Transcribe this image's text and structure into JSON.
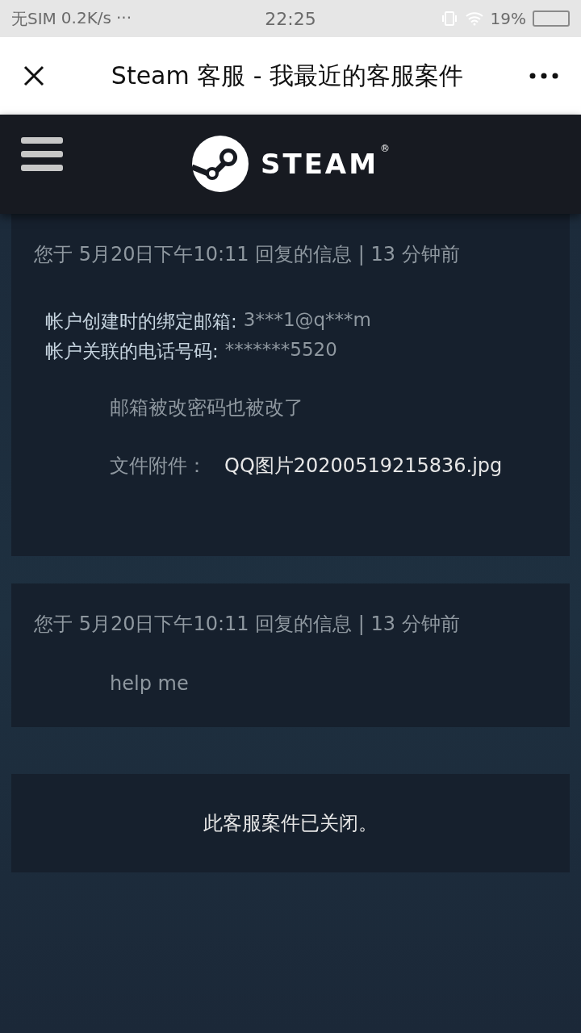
{
  "status_bar": {
    "carrier": "无SIM",
    "speed": "0.2K/s",
    "more": "···",
    "time": "22:25",
    "battery": "19%"
  },
  "title_bar": {
    "title": "Steam 客服 - 我最近的客服案件"
  },
  "brand": {
    "wordmark": "STEAM",
    "mark": "®"
  },
  "messages": [
    {
      "header": "您于 5月20日下午10:11 回复的信息 | 13 分钟前",
      "account_lines": [
        {
          "label": "帐户创建时的绑定邮箱:",
          "value": "3***1@q***m"
        },
        {
          "label": "帐户关联的电话号码:",
          "value": "*******5520"
        }
      ],
      "body": "邮箱被改密码也被改了",
      "attachment": {
        "label": "文件附件：",
        "file": "QQ图片20200519215836.jpg"
      }
    },
    {
      "header": "您于 5月20日下午10:11 回复的信息 | 13 分钟前",
      "body": "help me"
    }
  ],
  "notice": "此客服案件已关闭。"
}
